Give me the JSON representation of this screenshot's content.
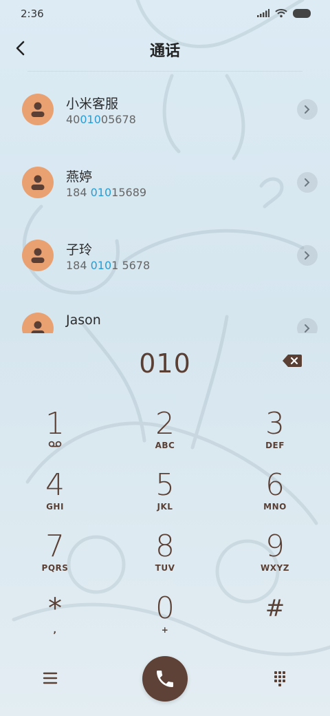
{
  "status_bar": {
    "time": "2:36"
  },
  "header": {
    "title": "通话"
  },
  "contacts": [
    {
      "name": "小米客服",
      "number_pre": "40",
      "number_hl": "010",
      "number_post": "05678"
    },
    {
      "name": "燕婷",
      "number_pre": "184 ",
      "number_hl": "010",
      "number_post": "15689"
    },
    {
      "name": "子玲",
      "number_pre": "184 ",
      "number_hl": "010",
      "number_post": "1 5678"
    },
    {
      "name": "Jason",
      "number_pre": "",
      "number_hl": "",
      "number_post": ""
    }
  ],
  "dialer": {
    "input": "010"
  },
  "keypad": [
    {
      "digit": "1",
      "letters": ""
    },
    {
      "digit": "2",
      "letters": "ABC"
    },
    {
      "digit": "3",
      "letters": "DEF"
    },
    {
      "digit": "4",
      "letters": "GHI"
    },
    {
      "digit": "5",
      "letters": "JKL"
    },
    {
      "digit": "6",
      "letters": "MNO"
    },
    {
      "digit": "7",
      "letters": "PQRS"
    },
    {
      "digit": "8",
      "letters": "TUV"
    },
    {
      "digit": "9",
      "letters": "WXYZ"
    },
    {
      "digit": "*",
      "letters": ","
    },
    {
      "digit": "0",
      "letters": "+"
    },
    {
      "digit": "#",
      "letters": ""
    }
  ],
  "icons": {
    "back": "chevron-left-icon",
    "backspace": "backspace-icon",
    "voicemail": "voicemail-icon",
    "menu": "menu-icon",
    "call": "phone-icon",
    "keypad": "dialpad-icon"
  },
  "colors": {
    "accent_highlight": "#2a9bd3",
    "avatar": "#e9a171",
    "key_text": "#5a3f34",
    "call_button": "#5e4137"
  }
}
